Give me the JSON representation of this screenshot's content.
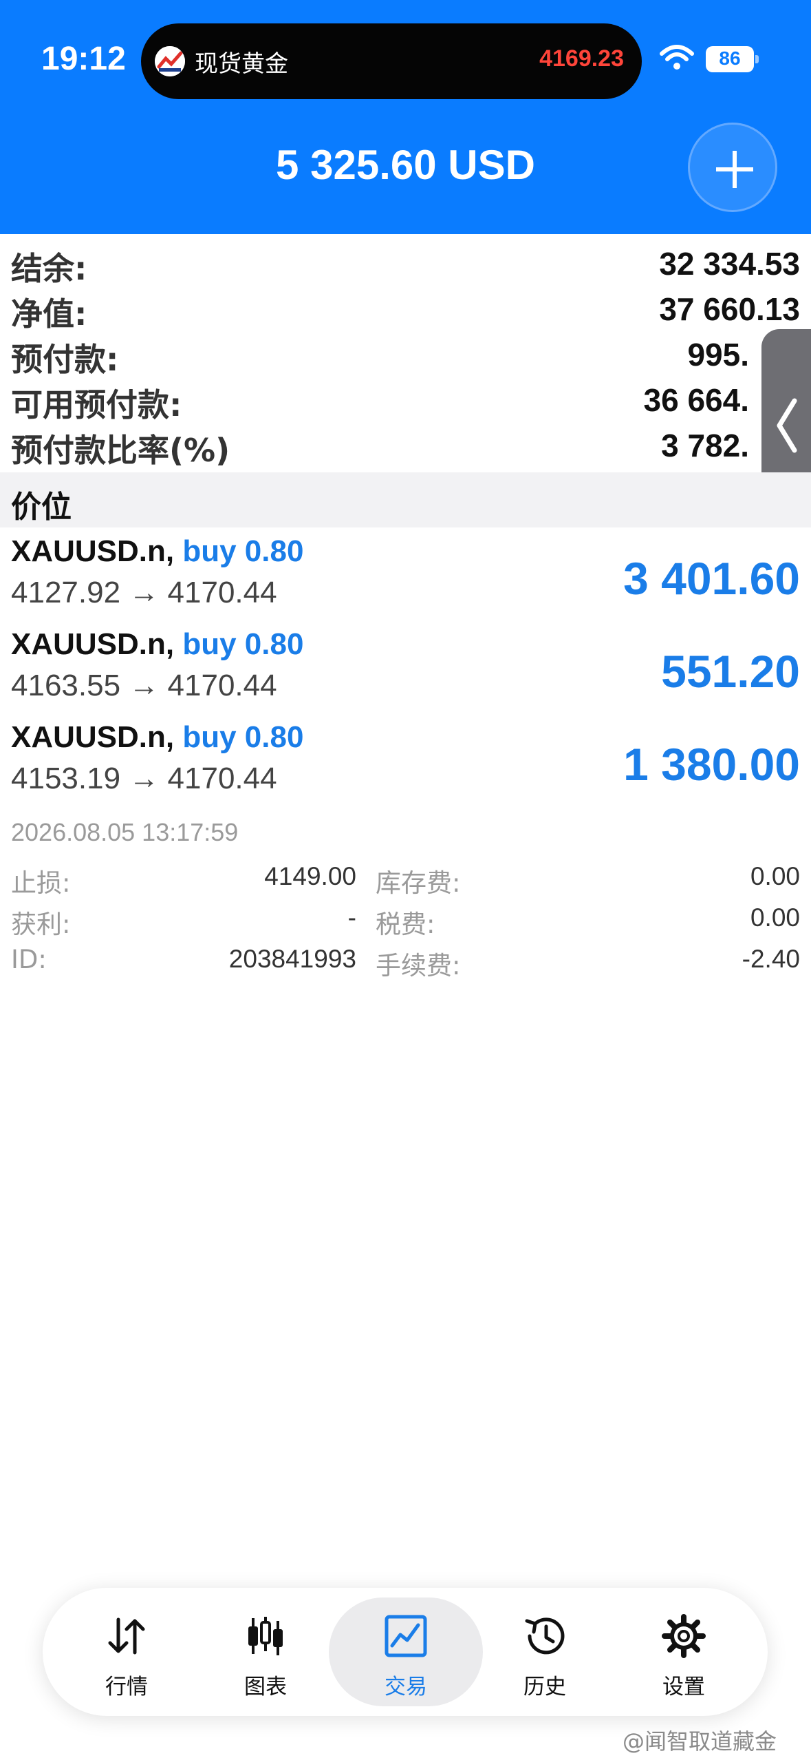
{
  "status_bar": {
    "time": "19:12",
    "live_activity": {
      "title": "现货黄金",
      "price": "4169.23"
    },
    "battery": "86",
    "wifi_icon": "wifi-icon"
  },
  "header": {
    "balance": "5 325.60 USD",
    "add_icon": "plus-icon"
  },
  "account": {
    "balance_label": "结余:",
    "balance_value": "32 334.53",
    "equity_label": "净值:",
    "equity_value": "37 660.13",
    "margin_label": "预付款:",
    "margin_value": "995.",
    "free_margin_label": "可用预付款:",
    "free_margin_value": "36 664.",
    "margin_level_label": "预付款比率(%)",
    "margin_level_value": "3 782."
  },
  "section": {
    "title": "价位"
  },
  "positions": [
    {
      "symbol": "XAUUSD.n,",
      "side": "buy 0.80",
      "open": "4127.92",
      "arrow": "→",
      "current": "4170.44",
      "profit": "3 401.60"
    },
    {
      "symbol": "XAUUSD.n,",
      "side": "buy 0.80",
      "open": "4163.55",
      "arrow": "→",
      "current": "4170.44",
      "profit": "551.20"
    },
    {
      "symbol": "XAUUSD.n,",
      "side": "buy 0.80",
      "open": "4153.19",
      "arrow": "→",
      "current": "4170.44",
      "profit": "1 380.00"
    }
  ],
  "details": {
    "date": "2026.08.05 13:17:59",
    "sl_label": "止损:",
    "sl_value": "4149.00",
    "swap_label": "库存费:",
    "swap_value": "0.00",
    "tp_label": "获利:",
    "tp_value": "-",
    "tax_label": "税费:",
    "tax_value": "0.00",
    "id_label": "ID:",
    "id_value": "203841993",
    "commission_label": "手续费:",
    "commission_value": "-2.40"
  },
  "nav": {
    "items": [
      {
        "label": "行情",
        "icon": "quotes-arrows-icon",
        "active": false
      },
      {
        "label": "图表",
        "icon": "candlestick-icon",
        "active": false
      },
      {
        "label": "交易",
        "icon": "trade-chart-icon",
        "active": true
      },
      {
        "label": "历史",
        "icon": "history-clock-icon",
        "active": false
      },
      {
        "label": "设置",
        "icon": "gear-icon",
        "active": false
      }
    ]
  },
  "watermark": "@闻智取道藏金",
  "colors": {
    "header": "#0a7cff",
    "accent": "#1a7de8",
    "island_price": "#ff453a"
  }
}
